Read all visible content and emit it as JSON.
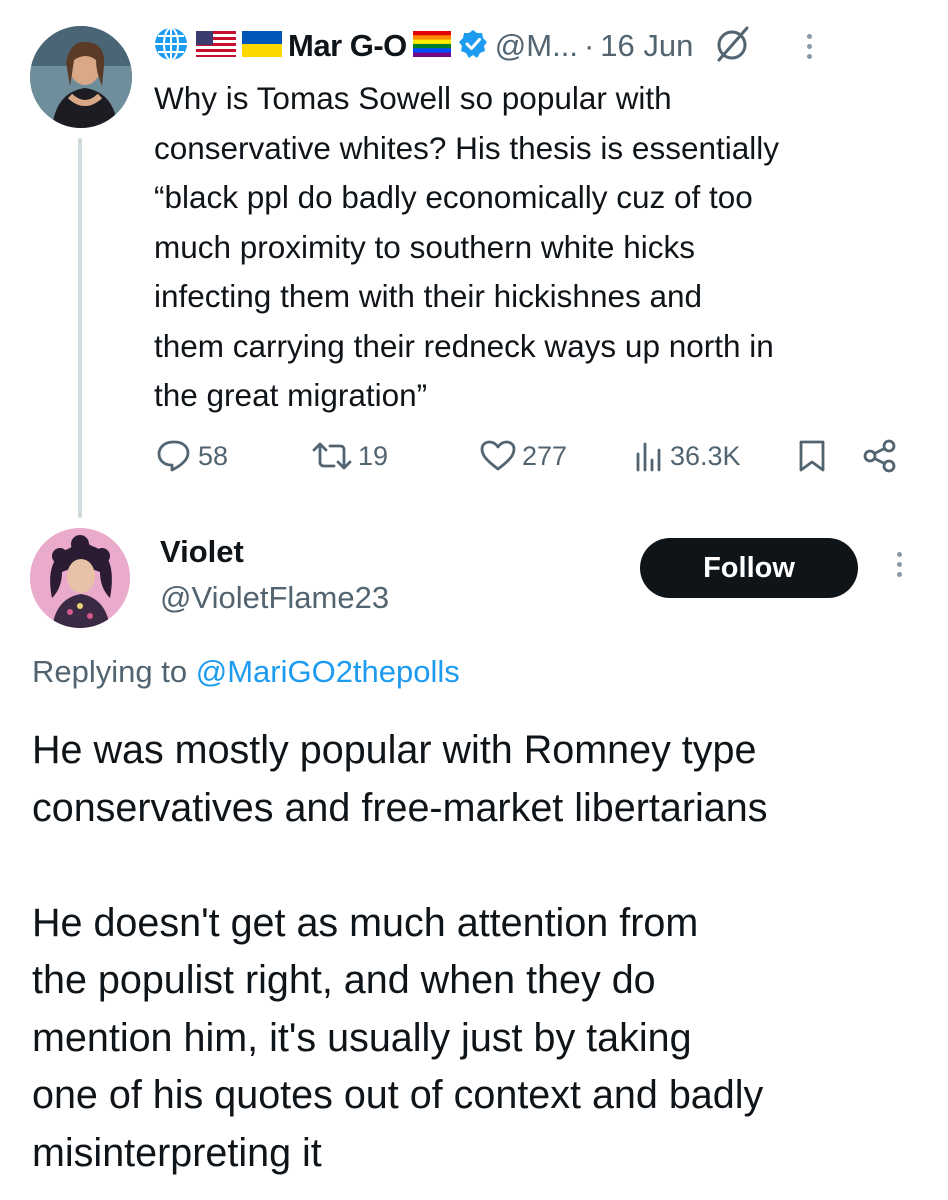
{
  "parent_tweet": {
    "display_name": "Mar G-O",
    "handle": "@M...",
    "separator": "·",
    "date": "16 Jun",
    "text": "Why is Tomas Sowell so popular with\nconservative whites? His thesis is essentially\n“black ppl do badly economically cuz of too\nmuch proximity to southern white hicks\ninfecting them with their hickishnes and\nthem carrying their redneck ways up north in\nthe great migration”",
    "stats": {
      "replies": "58",
      "reposts": "19",
      "likes": "277",
      "views": "36.3K"
    },
    "icons": [
      "globe-icon",
      "us-flag-icon",
      "ukraine-flag-icon",
      "rainbow-flag-icon",
      "verified-badge-icon",
      "grok-icon",
      "more-icon"
    ]
  },
  "reply_tweet": {
    "display_name": "Violet",
    "handle": "@VioletFlame23",
    "follow_label": "Follow",
    "replying_prefix": "Replying to",
    "replying_to": "@MariGO2thepolls",
    "text": "He was mostly popular with Romney type\nconservatives and free-market libertarians\n\nHe doesn't get as much attention from\nthe populist right, and when they do\nmention him, it's usually just by taking\none of his quotes out of context and badly\nmisinterpreting it"
  },
  "colors": {
    "text": "#0f1419",
    "secondary": "#536471",
    "link": "#1d9bf0",
    "verified": "#1d9bf0",
    "follow_bg": "#0f1419",
    "thread_line": "#cfd9de"
  }
}
